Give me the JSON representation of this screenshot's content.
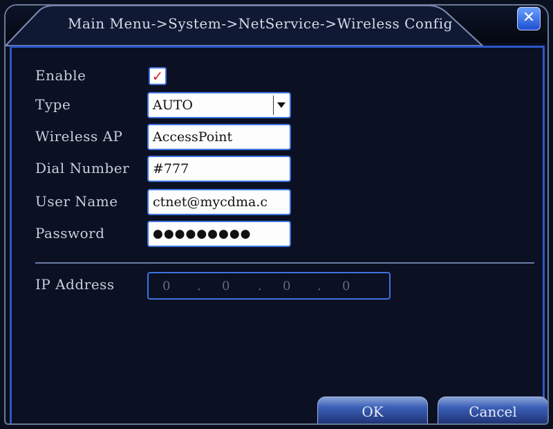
{
  "window": {
    "title": "Main Menu->System->NetService->Wireless Config",
    "close_icon": "close-icon"
  },
  "form": {
    "enable_label": "Enable",
    "enable_checked": true,
    "enable_mark": "✓",
    "type_label": "Type",
    "type_value": "AUTO",
    "wireless_ap_label": "Wireless AP",
    "wireless_ap_value": "AccessPoint",
    "dial_number_label": "Dial Number",
    "dial_number_value": "#777",
    "user_name_label": "User Name",
    "user_name_value": "ctnet@mycdma.c",
    "password_label": "Password",
    "password_value": "●●●●●●●●●",
    "ip_address_label": "IP Address",
    "ip_address_parts": [
      "0",
      "0",
      "0",
      "0"
    ]
  },
  "buttons": {
    "ok": "OK",
    "cancel": "Cancel"
  },
  "colors": {
    "accent": "#2d58c8",
    "background": "#0b1022",
    "text": "#c9cfde"
  }
}
